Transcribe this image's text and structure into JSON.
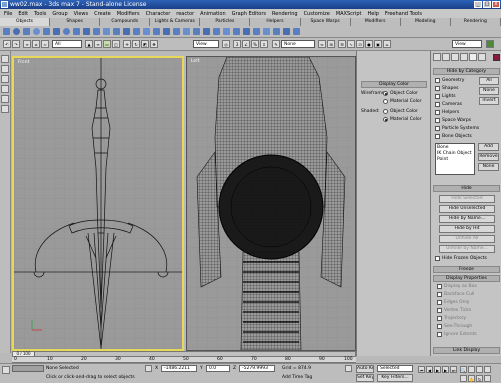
{
  "window": {
    "title": "ww02.max - 3ds max 7 - Stand-alone License",
    "min": "_",
    "max": "□",
    "close": "x"
  },
  "menu": [
    "File",
    "Edit",
    "Tools",
    "Group",
    "Views",
    "Create",
    "Modifiers",
    "Character",
    "reactor",
    "Animation",
    "Graph Editors",
    "Rendering",
    "Customize",
    "MAXScript",
    "Help",
    "Freehand Tools"
  ],
  "tabs": [
    "Objects",
    "Shapes",
    "Compounds",
    "Lights & Cameras",
    "Particles",
    "Helpers",
    "Space Warps",
    "Modifiers",
    "Modeling",
    "Rendering"
  ],
  "active_tab": 0,
  "toolbar": {
    "selection_filter": "All",
    "ref_coord": "View",
    "named_sel": "None",
    "view_dropdown": "View"
  },
  "viewports": {
    "left_label": "Front",
    "right_label": "Left",
    "frame_counter": "0 / 100"
  },
  "display_color": {
    "title": "Display Color",
    "wireframe_label": "Wireframe:",
    "wireframe_opt1": "Object Color",
    "wireframe_opt2": "Material Color",
    "shaded_label": "Shaded:",
    "shaded_opt1": "Object Color",
    "shaded_opt2": "Material Color"
  },
  "command_panel": {
    "hide_by_category": "Hide by Category",
    "categories": [
      "Geometry",
      "Shapes",
      "Lights",
      "Cameras",
      "Helpers",
      "Space Warps",
      "Particle Systems",
      "Bone Objects"
    ],
    "all_btn": "All",
    "none_btn": "None",
    "invert_btn": "Invert",
    "list_items": [
      "Bone",
      "IK Chain Object",
      "Point"
    ],
    "add_btn": "Add",
    "remove_btn": "Remove",
    "none2_btn": "None",
    "hide_section": "Hide",
    "hide_buttons": [
      "Hide Selected",
      "Hide Unselected",
      "Hide by Name...",
      "Hide by Hit",
      "Unhide All",
      "Unhide by Name..."
    ],
    "hide_frozen": "Hide Frozen Objects",
    "freeze_section": "Freeze",
    "display_props_section": "Display Properties",
    "display_props": [
      "Display as Box",
      "Backface Cull",
      "Edges Only",
      "Vertex Ticks",
      "Trajectory",
      "See-Through",
      "Ignore Extents",
      "Show Frozen in Gray",
      "Never Degrade",
      "Vertex Colors"
    ],
    "link_display": "Link Display"
  },
  "timeline_ticks": [
    "0",
    "10",
    "20",
    "30",
    "40",
    "50",
    "60",
    "70",
    "80",
    "90",
    "100"
  ],
  "status": {
    "selection": "None Selected",
    "prompt": "Click or click-and-drag to select objects",
    "x_val": "-1486.2211",
    "y_val": "0.0",
    "z_val": "-5279.9993",
    "grid": "Grid = 874.9",
    "add_time_tag": "Add Time Tag",
    "auto_key": "Auto Key",
    "set_key": "Set Key",
    "key_mode": "Selected",
    "key_filters": "Key Filters..."
  }
}
